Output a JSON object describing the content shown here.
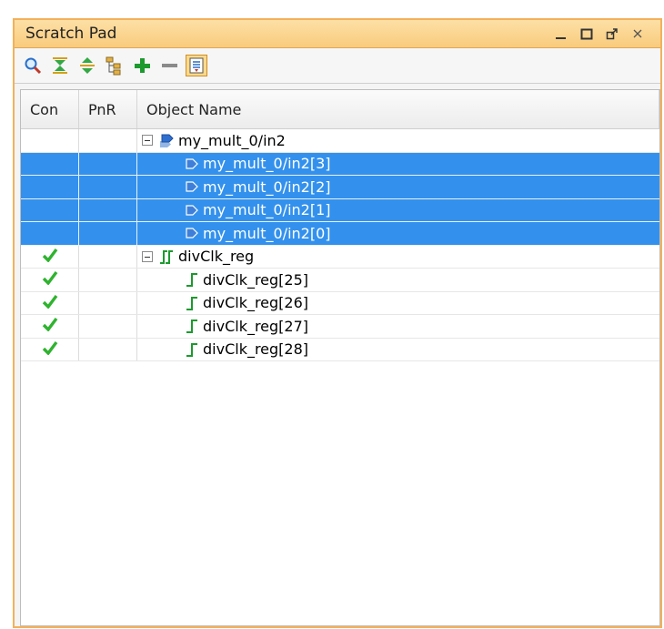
{
  "window": {
    "title": "Scratch Pad",
    "controls": [
      "minimize-icon",
      "maximize-icon",
      "float-icon",
      "close-icon"
    ]
  },
  "toolbar": {
    "buttons": [
      {
        "icon": "search-icon"
      },
      {
        "icon": "collapse-all-icon"
      },
      {
        "icon": "expand-all-icon"
      },
      {
        "icon": "hierarchy-icon"
      },
      {
        "icon": "add-icon"
      },
      {
        "icon": "remove-icon"
      },
      {
        "icon": "toggle-icon",
        "pressed": true
      }
    ]
  },
  "table": {
    "headers": {
      "con": "Con",
      "pnr": "PnR",
      "name": "Object Name"
    },
    "rows": [
      {
        "name": "my_mult_0/in2",
        "level": 0,
        "expandable": true,
        "icon": "bus-pin-icon",
        "selected": false,
        "con": false
      },
      {
        "name": "my_mult_0/in2[3]",
        "level": 1,
        "icon": "pin-icon",
        "selected": true,
        "con": false
      },
      {
        "name": "my_mult_0/in2[2]",
        "level": 1,
        "icon": "pin-icon",
        "selected": true,
        "con": false
      },
      {
        "name": "my_mult_0/in2[1]",
        "level": 1,
        "icon": "pin-icon",
        "selected": true,
        "con": false
      },
      {
        "name": "my_mult_0/in2[0]",
        "level": 1,
        "icon": "pin-icon",
        "selected": true,
        "con": false
      },
      {
        "name": "divClk_reg",
        "level": 0,
        "expandable": true,
        "icon": "register-bus-icon",
        "selected": false,
        "con": true
      },
      {
        "name": "divClk_reg[25]",
        "level": 1,
        "icon": "register-icon",
        "selected": false,
        "con": true
      },
      {
        "name": "divClk_reg[26]",
        "level": 1,
        "icon": "register-icon",
        "selected": false,
        "con": true
      },
      {
        "name": "divClk_reg[27]",
        "level": 1,
        "icon": "register-icon",
        "selected": false,
        "con": true
      },
      {
        "name": "divClk_reg[28]",
        "level": 1,
        "icon": "register-icon",
        "selected": false,
        "con": true
      }
    ]
  },
  "colors": {
    "title_border": "#f2b15b",
    "selection": "#3391ed",
    "check": "#2fb32f"
  }
}
